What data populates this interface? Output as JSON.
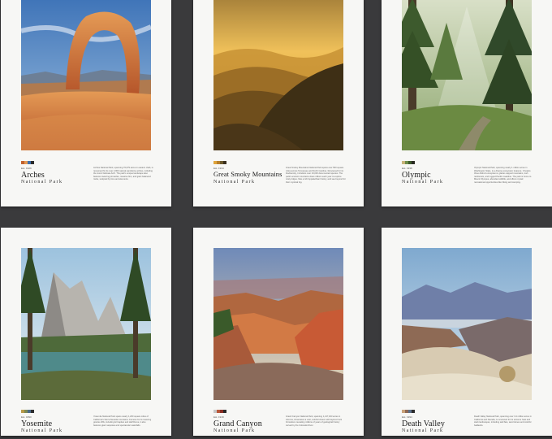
{
  "posters": [
    {
      "name": "Arches",
      "subtitle": "National Park",
      "established": "Est. 1929",
      "description": "Arches National Park, spanning 76,679 acres in eastern Utah, is renowned for its over 2,000 natural sandstone arches, including the iconic Delicate Arch. The park's unique landscape also features towering pinnacles, massive fins, and giant balanced rocks, sculpted by time and elements.",
      "palette": [
        "#c1612f",
        "#e49a55",
        "#3b6fae",
        "#2b2b2b"
      ]
    },
    {
      "name": "Great Smoky Mountains",
      "subtitle": "National Park",
      "established": "Est. 1934",
      "description": "Great Smoky Mountains National Park spans over 500 square miles across Tennessee and North Carolina. Renowned for its biodiversity, it shelters over 19,000 documented species. The park's ancient mountains draw millions each year to explore misty ridges, hike a rich Appalachian history, and see beyond for their mystical fog.",
      "palette": [
        "#e0a43a",
        "#b57e2a",
        "#6d5a2b",
        "#3a3020"
      ]
    },
    {
      "name": "Olympic",
      "subtitle": "National Park",
      "established": "Est. 1938",
      "description": "Olympic National Park, spanning nearly 1 million acres in Washington State, is a diverse ecosystem treasure. It boasts three distinct ecosystems: glacier-capped mountains, lush rainforests, and rugged Pacific coastline. The park is home to Mount Olympus, abundant wildlife, and offers myriad recreational opportunities like hiking and camping.",
      "palette": [
        "#c8b47a",
        "#6f8e4a",
        "#3d5a2d",
        "#2a2a22"
      ]
    },
    {
      "name": "Yosemite",
      "subtitle": "National Park",
      "established": "Est. 1890",
      "description": "Yosemite National Park spans nearly 1,200 square miles of California's Sierra Nevada mountains. Famous for its towering granite cliffs, including El Capitan and Half Dome, it also features giant sequoias and spectacular waterfalls.",
      "palette": [
        "#b89a4a",
        "#7c8a55",
        "#4a6a8a",
        "#2d2d2d"
      ]
    },
    {
      "name": "Grand Canyon",
      "subtitle": "National Park",
      "established": "Est. 1919",
      "description": "Grand Canyon National Park, spanning 1,217,403 acres in Arizona, showcases a vast, colorful chasm with layered rock formations revealing millions of years of geological history carved by the Colorado River.",
      "palette": [
        "#c7c7c7",
        "#b8573a",
        "#8a2f24",
        "#2b2b2b"
      ]
    },
    {
      "name": "Death Valley",
      "subtitle": "National Park",
      "established": "Est. 1994",
      "description": "Death Valley National Park, spanning over 3.4 million acres in California and Nevada, is renowned for its extreme heat and stark landscapes, including salt flats, sand dunes and colorful badlands.",
      "palette": [
        "#c9a27a",
        "#8e6a55",
        "#5b6f8a",
        "#2d2d2d"
      ]
    }
  ]
}
